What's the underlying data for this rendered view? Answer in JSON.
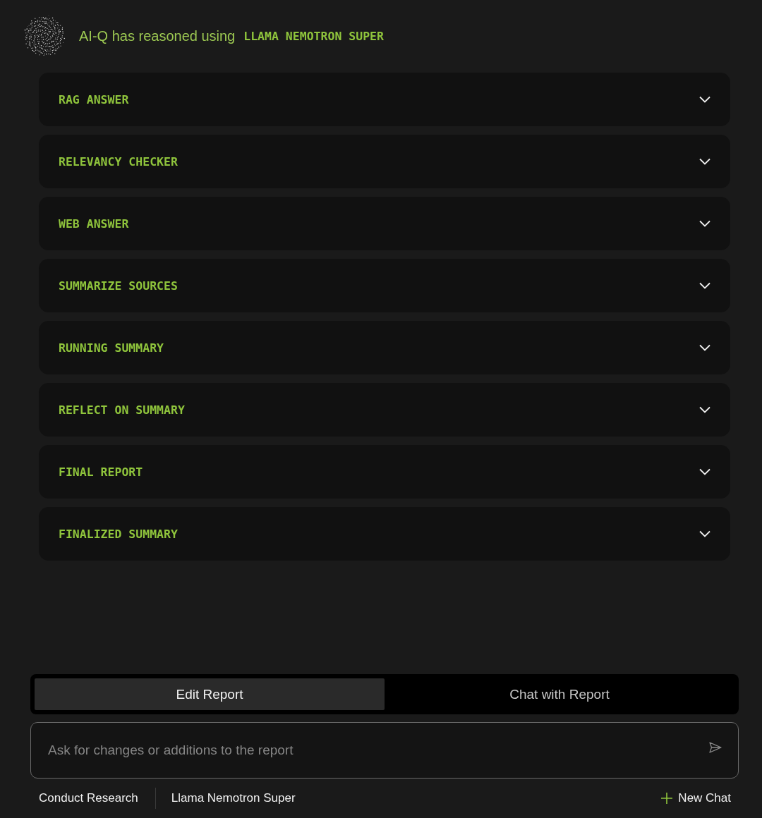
{
  "header": {
    "text": "AI-Q has reasoned using",
    "model": "LLAMA NEMOTRON SUPER"
  },
  "sections": [
    {
      "label": "RAG ANSWER",
      "expanded": false
    },
    {
      "label": "RELEVANCY CHECKER",
      "expanded": false
    },
    {
      "label": "WEB ANSWER",
      "expanded": false
    },
    {
      "label": "SUMMARIZE SOURCES",
      "expanded": false
    },
    {
      "label": "RUNNING SUMMARY",
      "expanded": false
    },
    {
      "label": "REFLECT ON SUMMARY",
      "expanded": false
    },
    {
      "label": "FINAL REPORT",
      "expanded": false
    },
    {
      "label": "FINALIZED SUMMARY",
      "expanded": false
    }
  ],
  "tabs": [
    {
      "label": "Edit Report",
      "selected": true
    },
    {
      "label": "Chat with Report",
      "selected": false
    }
  ],
  "input": {
    "placeholder": "Ask for changes or additions to the report"
  },
  "footer": {
    "mode": "Conduct Research",
    "model": "Llama Nemotron Super",
    "new_chat": "New Chat"
  }
}
